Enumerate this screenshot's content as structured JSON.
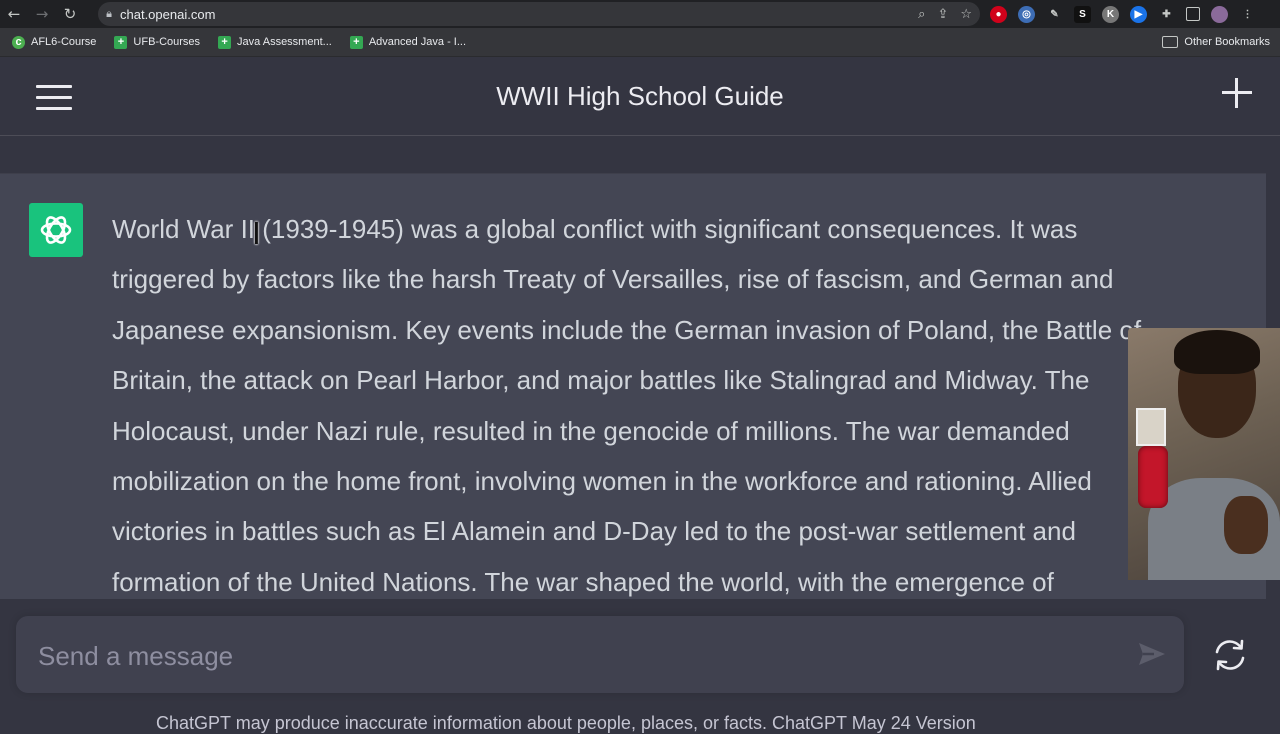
{
  "browser": {
    "url": "chat.openai.com",
    "bookmarks": [
      "AFL6-Course",
      "UFB-Courses",
      "Java Assessment...",
      "Advanced Java - I..."
    ],
    "other_bookmarks": "Other Bookmarks"
  },
  "header": {
    "title": "WWII High School Guide"
  },
  "message": {
    "lines": [
      "World War II (1939-1945) was a global conflict with significant consequences. It was",
      "triggered by factors like the harsh Treaty of Versailles, rise of fascism, and German and",
      "Japanese expansionism. Key events include the German invasion of Poland, the Battle of",
      "Britain, the attack on Pearl Harbor, and major battles like Stalingrad and Midway. The",
      "Holocaust, under Nazi rule, resulted in the genocide of millions. The war demanded",
      "mobilization on the home front, involving women in the workforce and rationing. Allied",
      "victories in battles such as El Alamein and D-Day led to the post-war settlement and",
      "formation of the United Nations. The war shaped the world, with the emergence of"
    ]
  },
  "composer": {
    "placeholder": "Send a message"
  },
  "footnote": "ChatGPT may produce inaccurate information about people, places, or facts. ChatGPT May 24 Version",
  "colors": {
    "assistant_avatar": "#19c37d",
    "page_bg": "#343541",
    "message_bg": "#444654"
  }
}
